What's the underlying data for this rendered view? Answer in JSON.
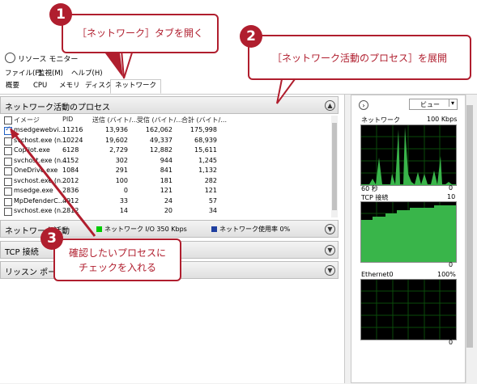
{
  "window": {
    "title": "リソース モニター"
  },
  "menu": [
    "ファイル(F)",
    "監視(M)",
    "ヘルプ(H)"
  ],
  "tabs": [
    "概要",
    "CPU",
    "メモリ",
    "ディスク",
    "ネットワーク"
  ],
  "process_section": {
    "title": "ネットワーク活動のプロセス",
    "columns": [
      "イメージ",
      "PID",
      "送信 (バイト/...",
      "受信 (バイト/...",
      "合計 (バイト/..."
    ],
    "rows": [
      {
        "image": "msedgewebvi...",
        "pid": "11216",
        "send": "13,936",
        "recv": "162,062",
        "total": "175,998",
        "checked": true
      },
      {
        "image": "svchost.exe (n...",
        "pid": "10224",
        "send": "19,602",
        "recv": "49,337",
        "total": "68,939",
        "checked": false
      },
      {
        "image": "Copilot.exe",
        "pid": "6128",
        "send": "2,729",
        "recv": "12,882",
        "total": "15,611",
        "checked": false
      },
      {
        "image": "svchost.exe (n...",
        "pid": "4152",
        "send": "302",
        "recv": "944",
        "total": "1,245",
        "checked": false
      },
      {
        "image": "OneDrive.exe",
        "pid": "1084",
        "send": "291",
        "recv": "841",
        "total": "1,132",
        "checked": false
      },
      {
        "image": "svchost.exe (n...",
        "pid": "2012",
        "send": "100",
        "recv": "181",
        "total": "282",
        "checked": false
      },
      {
        "image": "msedge.exe",
        "pid": "2836",
        "send": "0",
        "recv": "121",
        "total": "121",
        "checked": false
      },
      {
        "image": "MpDefenderC...",
        "pid": "4912",
        "send": "33",
        "recv": "24",
        "total": "57",
        "checked": false
      },
      {
        "image": "svchost.exe (n...",
        "pid": "2812",
        "send": "14",
        "recv": "20",
        "total": "34",
        "checked": false
      }
    ]
  },
  "network_section": {
    "title": "ネットワーク活動",
    "io_label": "ネットワーク I/O 350 Kbps",
    "usage_label": "ネットワーク使用率 0%",
    "io_color": "#00cc00",
    "usage_color": "#1f3fa0"
  },
  "tcp_section": {
    "title": "TCP 接続"
  },
  "listen_section": {
    "title": "リッスン ポート"
  },
  "right_panel": {
    "view_label": "ビュー",
    "graphs": [
      {
        "title": "ネットワーク",
        "scale": "100 Kbps",
        "footer_left": "60 秒",
        "footer_right": "0"
      },
      {
        "title": "TCP 接続",
        "scale": "10",
        "footer_left": "",
        "footer_right": "0"
      },
      {
        "title": "Ethernet0",
        "scale": "100%",
        "footer_left": "",
        "footer_right": "0"
      }
    ]
  },
  "callouts": [
    {
      "number": "1",
      "text": "［ネットワーク］タブを開く"
    },
    {
      "number": "2",
      "text": "［ネットワーク活動のプロセス］を展開"
    },
    {
      "number": "3",
      "line1": "確認したいプロセスに",
      "line2": "チェックを入れる"
    }
  ]
}
